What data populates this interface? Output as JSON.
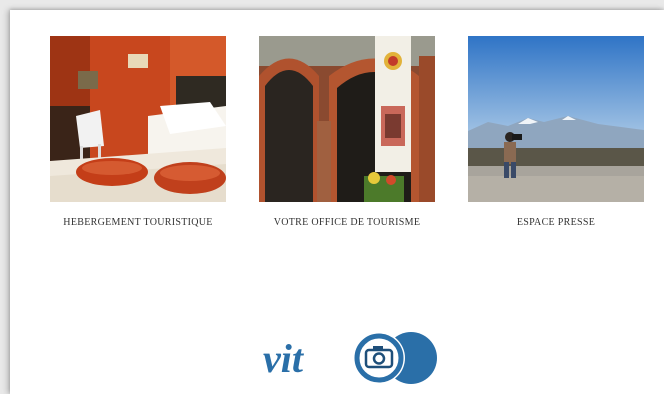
{
  "cards": [
    {
      "label": "HEBERGEMENT TOURISTIQUE"
    },
    {
      "label": "VOTRE OFFICE DE TOURISME"
    },
    {
      "label": "ESPACE PRESSE"
    }
  ],
  "logo": {
    "text": "vit"
  },
  "colors": {
    "logo_blue": "#2a6fa8",
    "logo_dark": "#1e4f7a"
  }
}
